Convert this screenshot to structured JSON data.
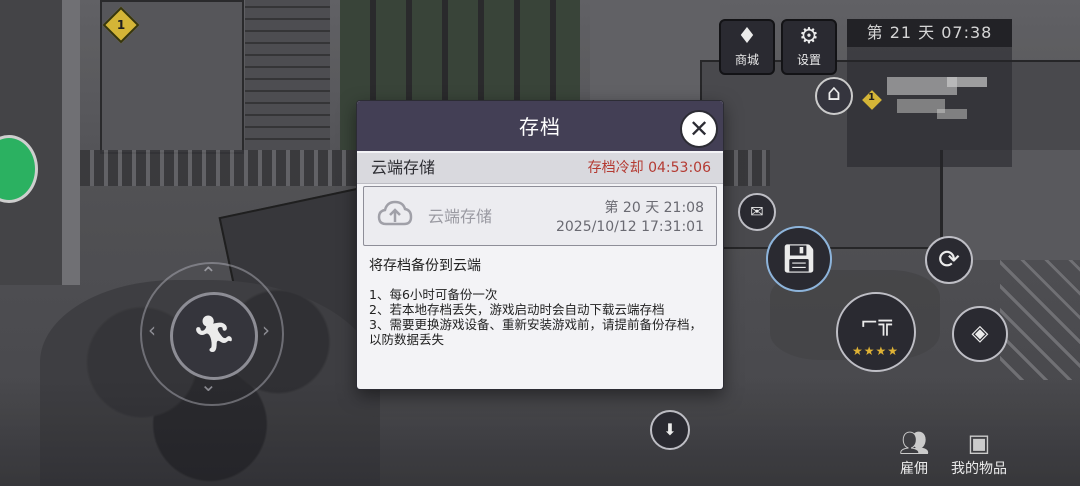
{
  "hud": {
    "shop_label": "商城",
    "settings_label": "设置",
    "day_time": "第 21 天  07:38",
    "hire_label": "雇佣",
    "items_label": "我的物品",
    "badge_count": "1",
    "minimap_badge": "1"
  },
  "icons": {
    "shop": "diamond-icon",
    "settings": "gear-icon",
    "hire": "group-icon",
    "items": "chest-icon",
    "run": "running-man-icon",
    "save": "save-icon",
    "mail": "mail-icon",
    "sync": "sync-icon",
    "weapon": "rifle-icon",
    "bear": "bear-trap-icon",
    "down": "down-arrow-icon",
    "close": "close-icon",
    "cloud": "cloud-upload-icon",
    "home": "home-icon"
  },
  "weapon_stars": "★★★★",
  "dialog": {
    "title": "存档",
    "cloud_section_label": "云端存储",
    "cooldown_text": "存档冷却 04:53:06",
    "slot": {
      "name": "云端存储",
      "day_time": "第 20 天  21:08",
      "date": "2025/10/12 17:31:01"
    },
    "description_title": "将存档备份到云端",
    "notes": [
      "1、每6小时可备份一次",
      "2、若本地存档丢失，游戏启动时会自动下载云端存档",
      "3、需要更换游戏设备、重新安装游戏前，请提前备份存档，以防数据丢失"
    ]
  },
  "colors": {
    "dialog_header": "#433f55",
    "cooldown": "#b43a32",
    "dialog_bg": "#f3f3f6"
  }
}
